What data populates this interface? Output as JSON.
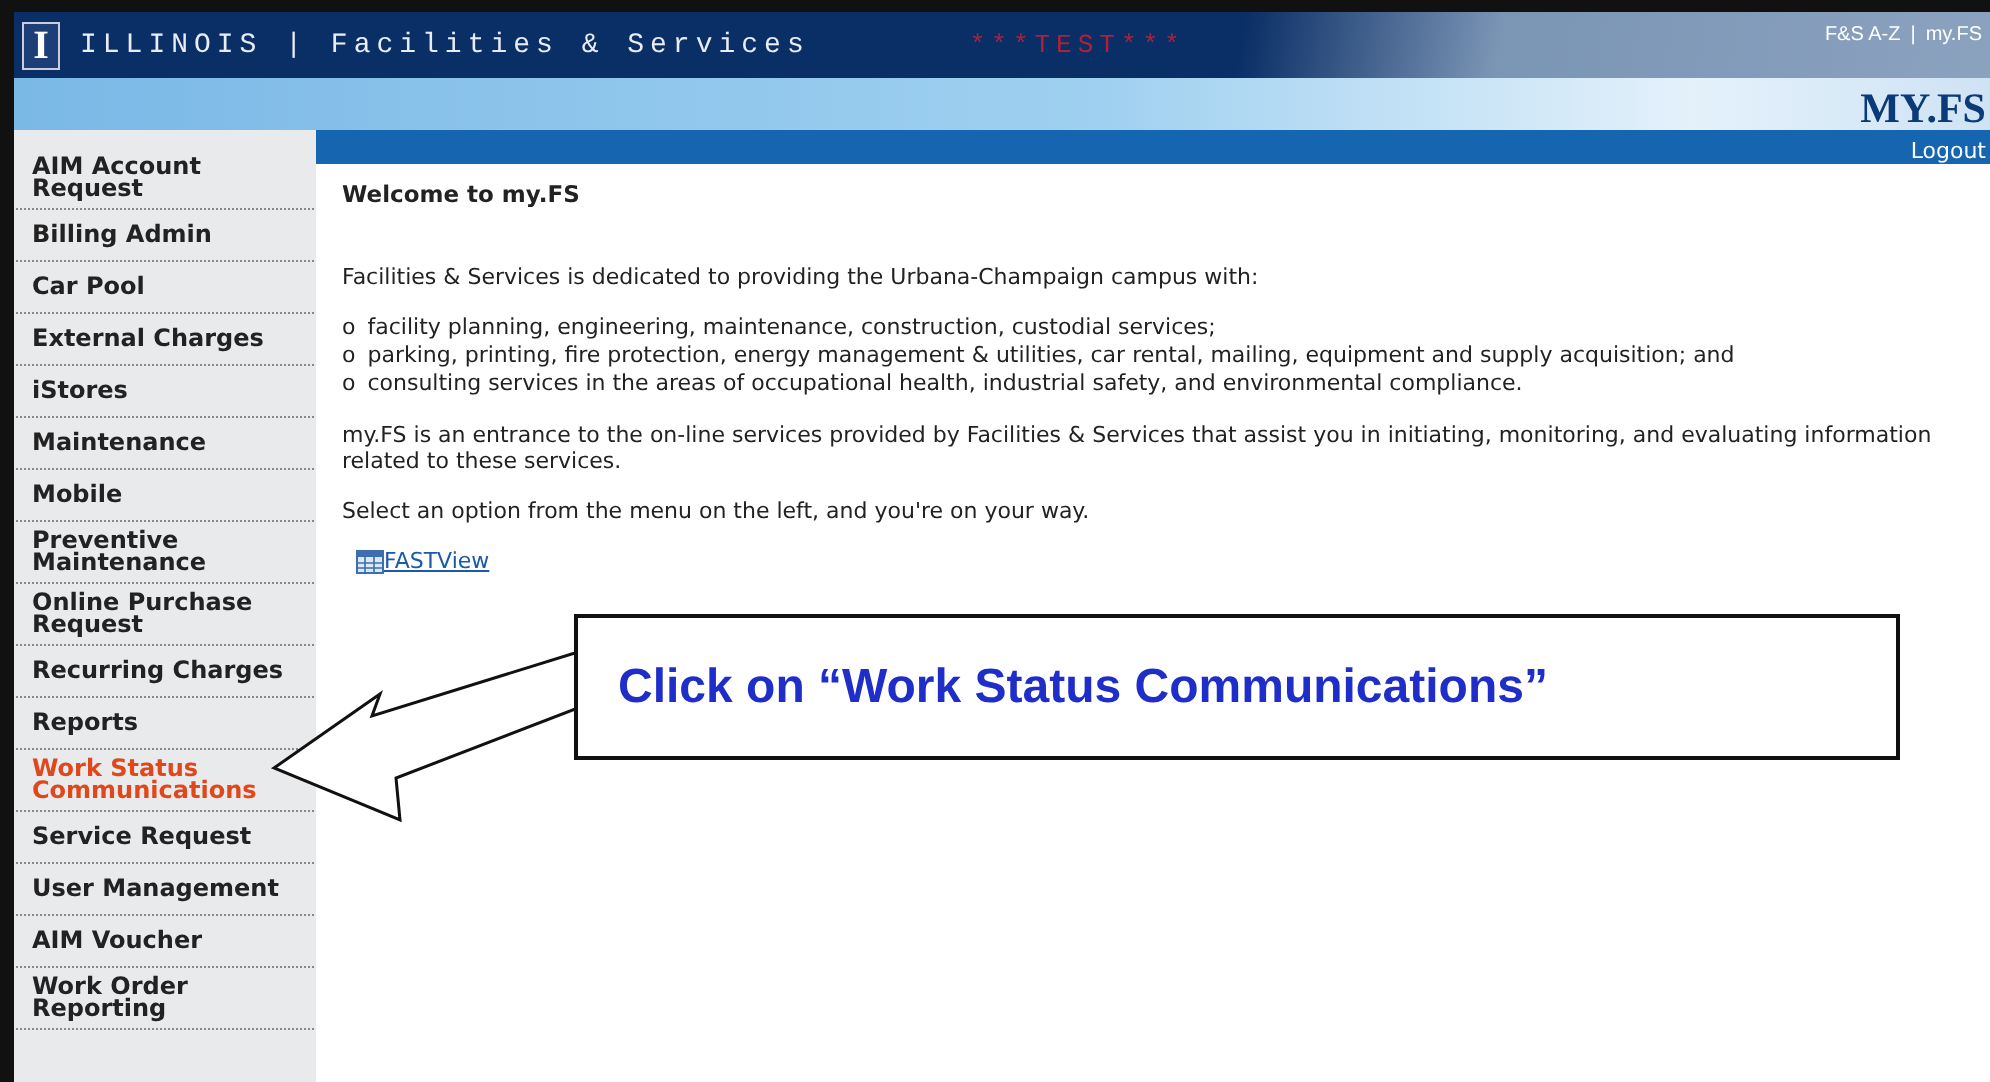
{
  "header": {
    "logo_letter": "I",
    "title": "ILLINOIS | Facilities & Services",
    "test_banner": "***TEST***",
    "links": [
      "F&S A-Z",
      "|",
      "my.FS"
    ],
    "brand": "MY.FS",
    "logout": "Logout"
  },
  "sidebar": {
    "items": [
      {
        "label": "AIM Account Request",
        "selected": false
      },
      {
        "label": "Billing Admin",
        "selected": false
      },
      {
        "label": "Car Pool",
        "selected": false
      },
      {
        "label": "External Charges",
        "selected": false
      },
      {
        "label": "iStores",
        "selected": false
      },
      {
        "label": "Maintenance",
        "selected": false
      },
      {
        "label": "Mobile",
        "selected": false
      },
      {
        "label": "Preventive Maintenance",
        "selected": false
      },
      {
        "label": "Online Purchase Request",
        "selected": false
      },
      {
        "label": "Recurring Charges",
        "selected": false
      },
      {
        "label": "Reports",
        "selected": false
      },
      {
        "label": "Work Status Communications",
        "selected": true
      },
      {
        "label": "Service Request",
        "selected": false
      },
      {
        "label": "User Management",
        "selected": false
      },
      {
        "label": "AIM Voucher",
        "selected": false
      },
      {
        "label": "Work Order Reporting",
        "selected": false
      }
    ]
  },
  "content": {
    "heading": "Welcome to my.FS",
    "intro": "Facilities & Services is dedicated to providing the Urbana-Champaign campus with:",
    "bullets": [
      {
        "marker": "o",
        "text": "facility planning, engineering, maintenance, construction, custodial services;"
      },
      {
        "marker": "o",
        "text": "parking, printing, fire protection, energy management & utilities, car rental, mailing, equipment and supply acquisition; and"
      },
      {
        "marker": "o",
        "text": "consulting services in the areas of occupational health, industrial safety, and environmental compliance."
      }
    ],
    "paragraphs": [
      "my.FS is an entrance to the on-line services provided by Facilities & Services that assist you in initiating, monitoring, and evaluating information related to these services.",
      "Select an option from the menu on the left, and you're on your way."
    ],
    "link": "FASTView"
  },
  "callout": {
    "text": "Click on “Work Status Communications”"
  }
}
